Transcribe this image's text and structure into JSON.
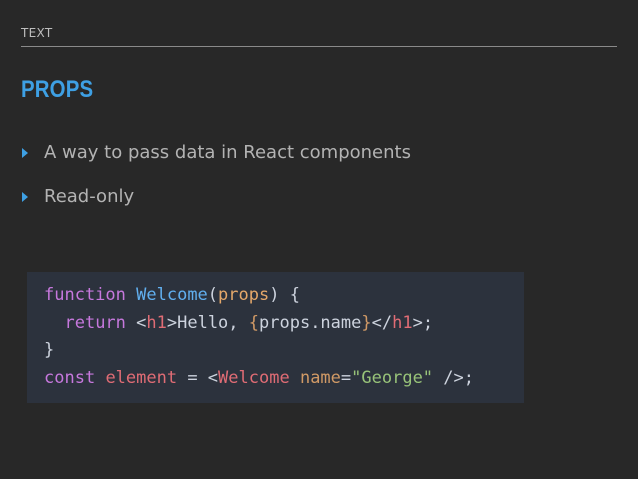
{
  "header": {
    "label": "TEXT"
  },
  "title": "PROPS",
  "bullets": [
    {
      "text": "A way to pass data in React components"
    },
    {
      "text": "Read-only"
    }
  ],
  "code": {
    "line1": {
      "kw": "function",
      "sp1": " ",
      "fn": "Welcome",
      "open": "(",
      "param": "props",
      "close": ") {"
    },
    "line2": {
      "indent": "  ",
      "kw": "return",
      "sp": " <",
      "tag": "h1",
      "mid": ">Hello, ",
      "brace": "{",
      "expr": "props.name",
      "brace_close": "}",
      "end1": "</",
      "tag_close": "h1",
      "end2": ">;"
    },
    "line3": {
      "text": "}"
    },
    "line4": {
      "kw": "const",
      "sp1": " ",
      "var": "element",
      "eq": " = <",
      "tag": "Welcome",
      "sp2": " ",
      "attr": "name",
      "assign": "=",
      "str": "\"George\"",
      "end": " />;"
    }
  },
  "colors": {
    "background": "#282828",
    "accent": "#3ea0e4",
    "code_background": "#2c323d"
  }
}
